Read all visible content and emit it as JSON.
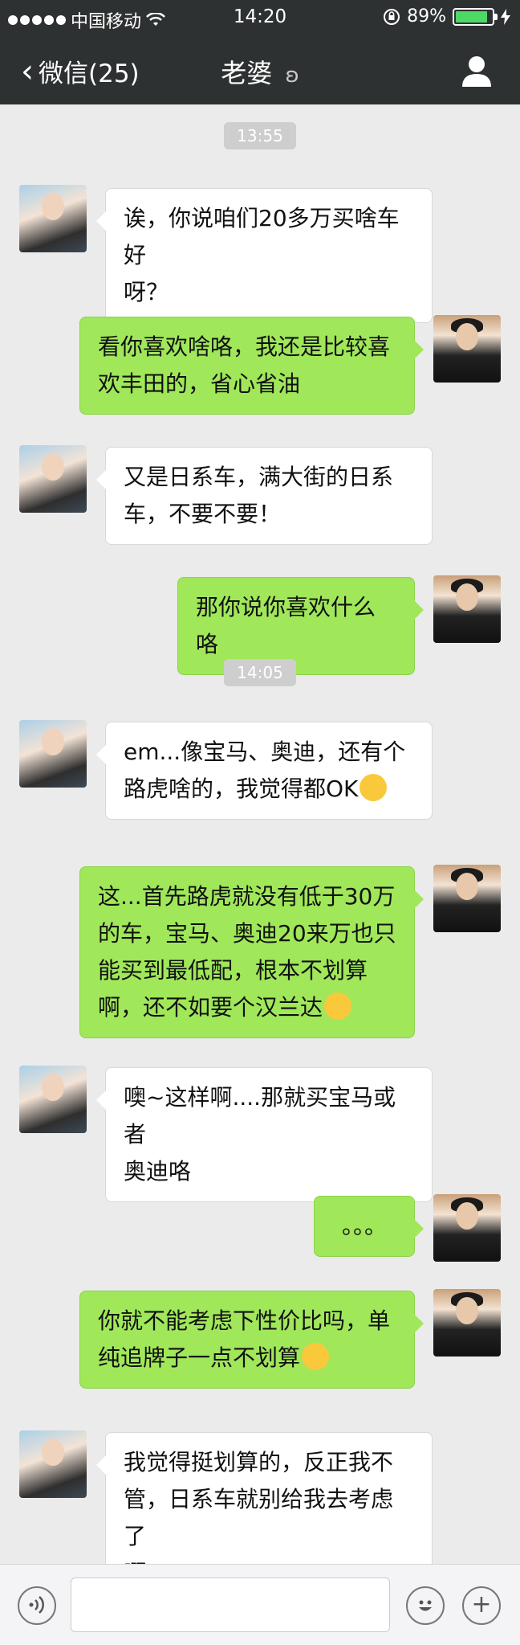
{
  "status_bar": {
    "carrier": "中国移动",
    "time": "14:20",
    "battery": "89%",
    "battery_level": 0.89
  },
  "nav": {
    "back_label": "微信(25)",
    "title": "老婆"
  },
  "timestamps": [
    "13:55",
    "14:05"
  ],
  "messages": [
    {
      "from": "her",
      "lines": [
        "诶，你说咱们20多万买啥车好",
        "呀？"
      ]
    },
    {
      "from": "him",
      "lines": [
        "看你喜欢啥咯，我还是比较喜",
        "欢丰田的，省心省油"
      ]
    },
    {
      "from": "her",
      "lines": [
        "又是日系车，满大街的日系",
        "车，不要不要！"
      ]
    },
    {
      "from": "him",
      "lines": [
        "那你说你喜欢什么咯"
      ]
    },
    {
      "from": "her",
      "lines": [
        "em...像宝马、奥迪，还有个",
        "路虎啥的，我觉得都OK"
      ],
      "emoji": "smile-emoji"
    },
    {
      "from": "him",
      "lines": [
        "这...首先路虎就没有低于30万",
        "的车，宝马、奥迪20来万也只",
        "能买到最低配，根本不划算",
        "啊，还不如要个汉兰达"
      ],
      "emoji": "flushed-emoji"
    },
    {
      "from": "her",
      "lines": [
        "噢~这样啊....那就买宝马或者",
        "奥迪咯"
      ]
    },
    {
      "from": "him",
      "lines": [
        "。。。"
      ]
    },
    {
      "from": "him",
      "lines": [
        "你就不能考虑下性价比吗，单",
        "纯追牌子一点不划算"
      ],
      "emoji": "laughing-emoji"
    },
    {
      "from": "her",
      "lines": [
        "我觉得挺划算的，反正我不",
        "管，日系车就别给我去考虑了",
        "啊！"
      ]
    }
  ]
}
